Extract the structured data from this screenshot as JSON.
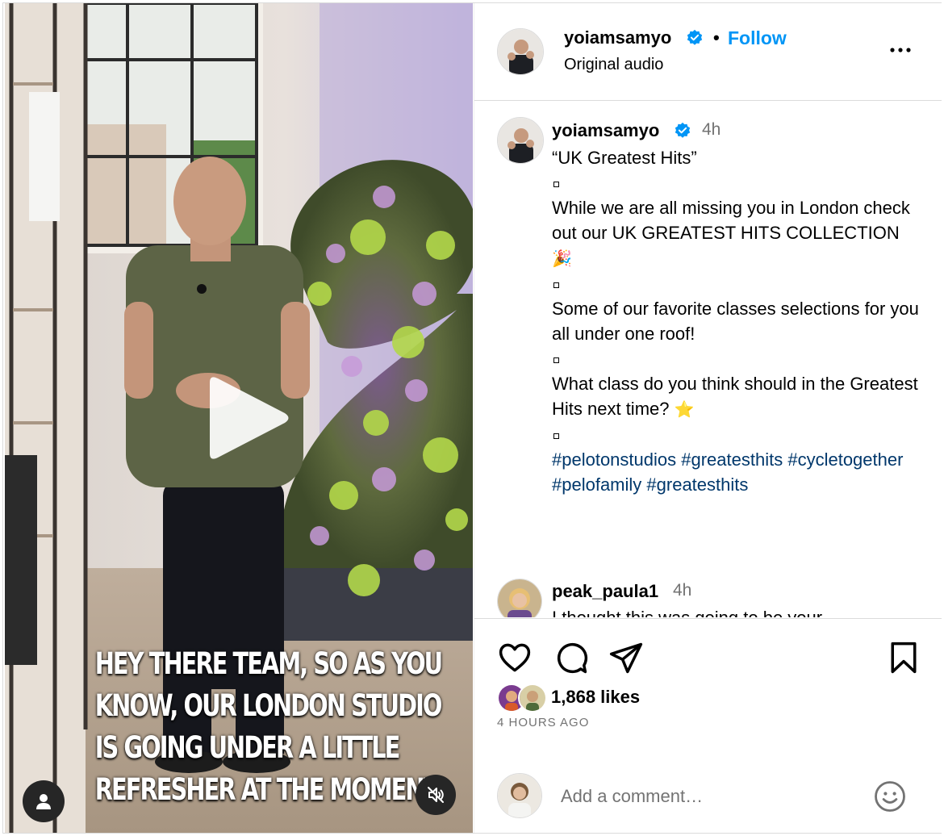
{
  "post": {
    "username": "yoiamsamyo",
    "follow_label": "Follow",
    "separator": "•",
    "audio_label": "Original audio"
  },
  "video": {
    "caption_lines": [
      "HEY THERE TEAM, SO AS YOU",
      "KNOW, OUR LONDON STUDIO",
      "IS GOING UNDER A LITTLE",
      "REFRESHER AT THE MOMENT,"
    ],
    "icons": {
      "play": "play-icon",
      "tagged_user": "user-icon",
      "mute": "speaker-muted-icon"
    }
  },
  "caption": {
    "username": "yoiamsamyo",
    "time": "4h",
    "title": "“UK Greatest Hits”",
    "para1": "While we are all missing you in London check out our UK GREATEST HITS COLLECTION",
    "para1_emoji": "🎉",
    "para2": "Some of our favorite classes selections for you all under one roof!",
    "para3": "What class do you think should in the Greatest Hits next time?",
    "para3_emoji": "⭐",
    "hashtags": [
      "#pelotonstudios",
      "#greatesthits",
      "#cycletogether",
      "#pelofamily",
      "#greatesthits"
    ]
  },
  "comment": {
    "username": "peak_paula1",
    "time": "4h",
    "text": "I thought this was going to be your"
  },
  "engagement": {
    "likes": "1,868 likes",
    "time_ago": "4 HOURS AGO"
  },
  "composer": {
    "placeholder": "Add a comment…"
  },
  "colors": {
    "accent": "#0095f6",
    "hashtag": "#00376b",
    "muted_text": "#737373",
    "verified": "#0095f6"
  }
}
